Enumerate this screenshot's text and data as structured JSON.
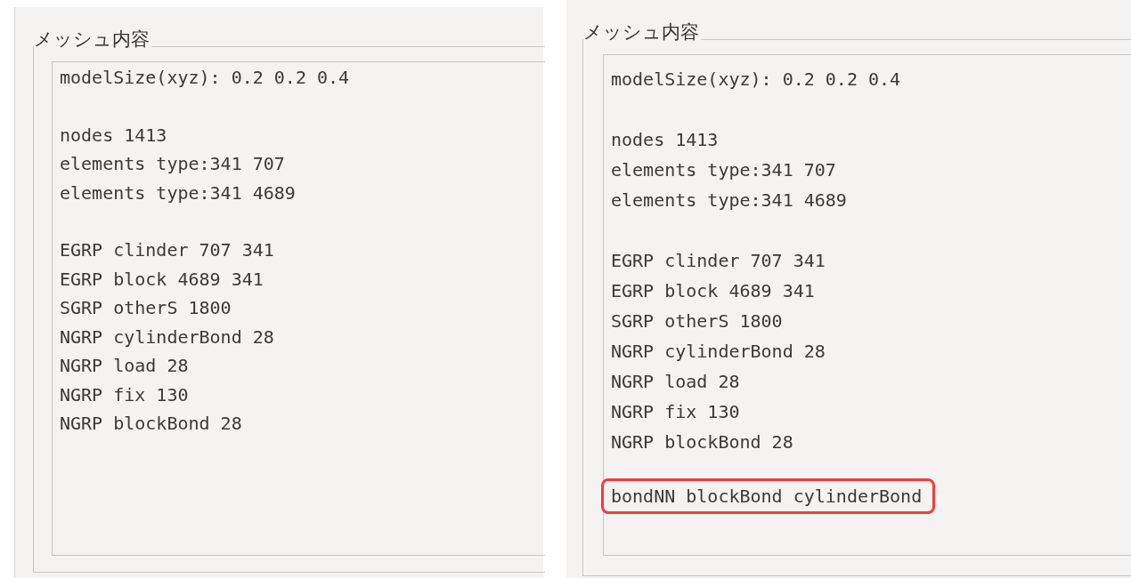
{
  "panels": [
    {
      "title": "メッシュ内容",
      "blocks": [
        {
          "highlighted": false,
          "lines": [
            "modelSize(xyz): 0.2 0.2 0.4"
          ]
        },
        {
          "highlighted": false,
          "lines": [
            "nodes 1413",
            "elements type:341 707",
            "elements type:341 4689"
          ]
        },
        {
          "highlighted": false,
          "lines": [
            "EGRP clinder 707 341",
            "EGRP block 4689 341",
            "SGRP otherS 1800",
            "NGRP cylinderBond 28",
            "NGRP load 28",
            "NGRP fix 130",
            "NGRP blockBond 28"
          ]
        }
      ]
    },
    {
      "title": "メッシュ内容",
      "blocks": [
        {
          "highlighted": false,
          "lines": [
            "modelSize(xyz): 0.2 0.2 0.4"
          ]
        },
        {
          "highlighted": false,
          "lines": [
            "nodes 1413",
            "elements type:341 707",
            "elements type:341 4689"
          ]
        },
        {
          "highlighted": false,
          "lines": [
            "EGRP clinder 707 341",
            "EGRP block 4689 341",
            "SGRP otherS 1800",
            "NGRP cylinderBond 28",
            "NGRP load 28",
            "NGRP fix 130",
            "NGRP blockBond 28"
          ]
        },
        {
          "highlighted": true,
          "lines": [
            "bondNN blockBond cylinderBond"
          ]
        }
      ]
    }
  ]
}
